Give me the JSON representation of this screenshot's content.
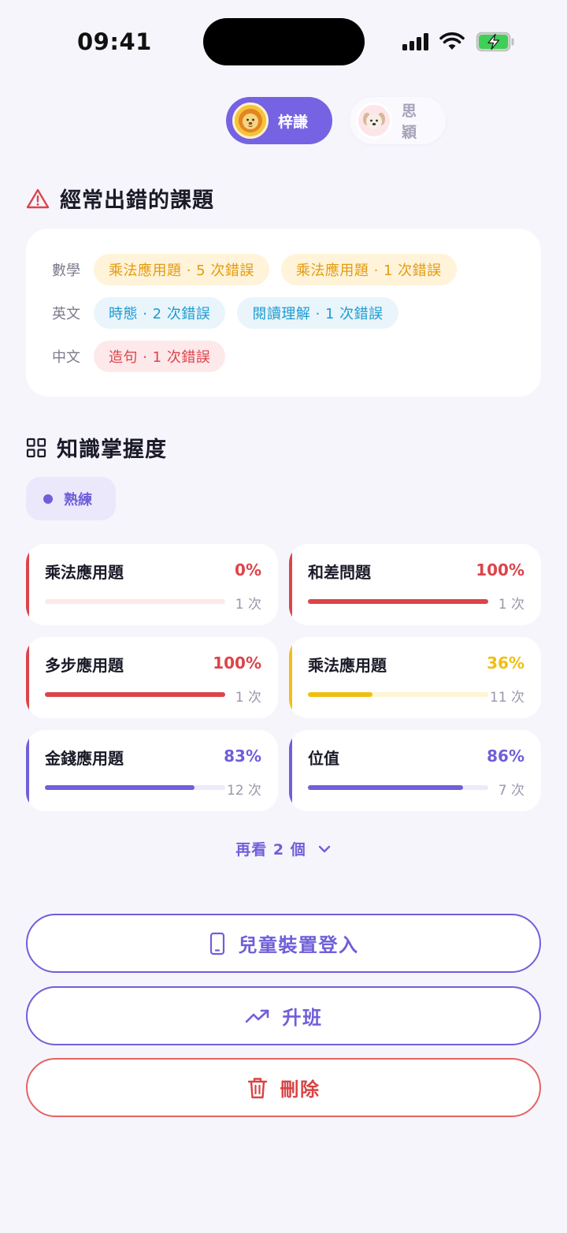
{
  "status_bar": {
    "time": "09:41"
  },
  "profiles": [
    {
      "name": "梓謙",
      "active": true,
      "avatar": "lion-avatar"
    },
    {
      "name": "思穎",
      "active": false,
      "avatar": "dog-avatar"
    }
  ],
  "mistakes": {
    "title": "經常出錯的課題",
    "icon": "warning-icon",
    "rows": [
      {
        "subject": "數學",
        "chips": [
          "乘法應用題 · 5 次錯誤",
          "乘法應用題 · 1 次錯誤"
        ]
      },
      {
        "subject": "英文",
        "chips": [
          "時態 · 2 次錯誤",
          "閱讀理解 · 1 次錯誤"
        ]
      },
      {
        "subject": "中文",
        "chips": [
          "造句 · 1 次錯誤"
        ]
      }
    ]
  },
  "mastery": {
    "title": "知識掌握度",
    "icon": "grid-icon",
    "legend_label": "熟練",
    "items": [
      {
        "name": "乘法應用題",
        "percent": "0%",
        "value": 0,
        "count": "1 次",
        "color": "#dc4449",
        "track": "#fde8ea"
      },
      {
        "name": "和差問題",
        "percent": "100%",
        "value": 100,
        "count": "1 次",
        "color": "#dc4449",
        "track": "#fde8ea"
      },
      {
        "name": "多步應用題",
        "percent": "100%",
        "value": 100,
        "count": "1 次",
        "color": "#dc4449",
        "track": "#fde8ea"
      },
      {
        "name": "乘法應用題",
        "percent": "36%",
        "value": 36,
        "count": "11 次",
        "color": "#f1bf12",
        "track": "#fff5d3"
      },
      {
        "name": "金錢應用題",
        "percent": "83%",
        "value": 83,
        "count": "12 次",
        "color": "#6f5fd9",
        "track": "#ecebfb"
      },
      {
        "name": "位值",
        "percent": "86%",
        "value": 86,
        "count": "7 次",
        "color": "#6f5fd9",
        "track": "#ecebfb"
      }
    ],
    "see_more": "再看 2 個"
  },
  "actions": {
    "device_login": "兒童裝置登入",
    "promote": "升班",
    "delete": "刪除"
  }
}
